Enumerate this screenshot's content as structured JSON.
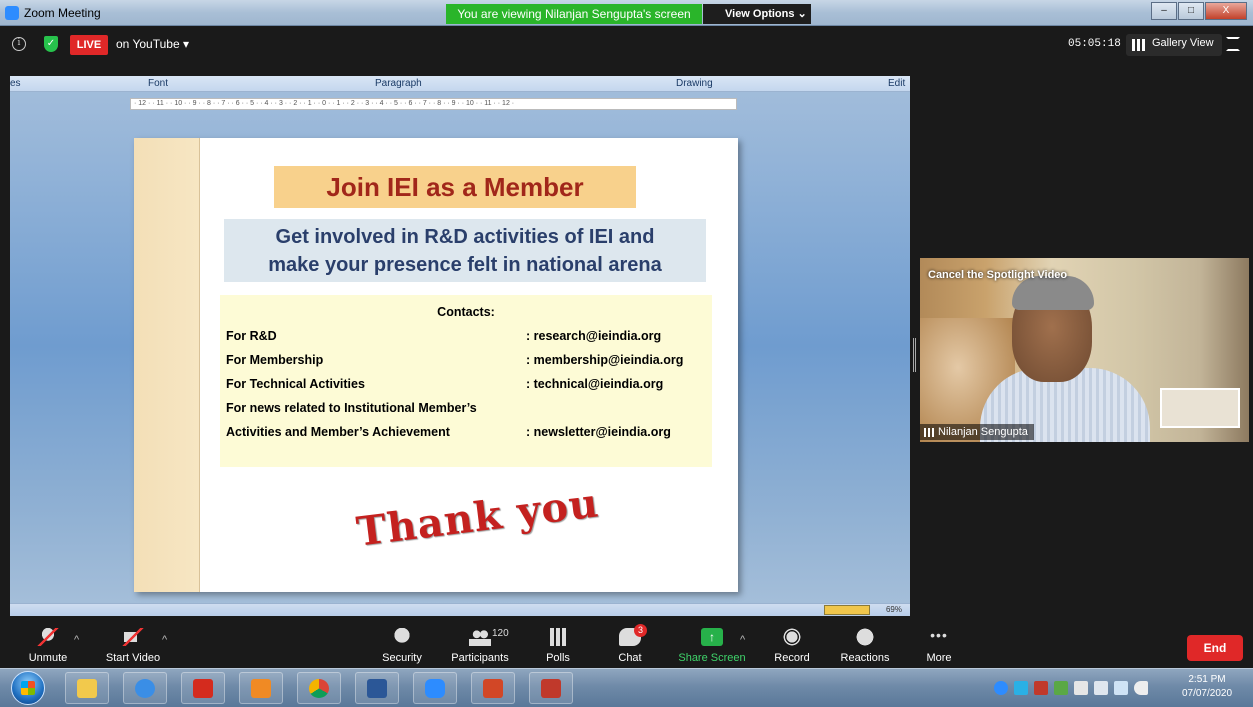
{
  "window": {
    "title": "Zoom Meeting",
    "viewing_banner": "You are viewing Nilanjan Sengupta's screen",
    "view_options": "View Options ⌄",
    "controls": [
      "–",
      "□",
      "X"
    ]
  },
  "meeting_bar": {
    "live_label": "LIVE",
    "live_destination": "on YouTube ▾",
    "timer": "05:05:18",
    "gallery_view": "Gallery View"
  },
  "shared_screen": {
    "ribbon_groups": [
      "es",
      "Font",
      "Paragraph",
      "Drawing",
      "Edit"
    ],
    "ruler_text": "· 12 · · 11 · · 10 · · 9 · · 8 · · 7 · · 6 · · 5 · · 4 · · 3 · · 2 · · 1 · · 0 · · 1 · · 2 · · 3 · · 4 · · 5 · · 6 · · 7 · · 8 · · 9 · · 10 · · 11 · · 12 ·",
    "zoom_level": "69%",
    "slide": {
      "title": "Join IEI as a Member",
      "subtitle_line1": "Get involved in R&D activities of IEI and",
      "subtitle_line2": "make your presence felt in national arena",
      "contacts_heading": "Contacts:",
      "contacts": [
        {
          "label": "For R&D",
          "value": ": research@ieindia.org"
        },
        {
          "label": "For Membership",
          "value": ": membership@ieindia.org"
        },
        {
          "label": "For Technical Activities",
          "value": ": technical@ieindia.org"
        },
        {
          "label": "For news related to Institutional Member’s",
          "value": ""
        },
        {
          "label": "Activities and Member’s Achievement",
          "value": ": newsletter@ieindia.org"
        }
      ],
      "closing": "Thank you"
    }
  },
  "video": {
    "spotlight_action": "Cancel the Spotlight Video",
    "participant_name": "Nilanjan Sengupta"
  },
  "toolbar": {
    "unmute": "Unmute",
    "start_video": "Start Video",
    "security": "Security",
    "participants": "Participants",
    "participants_count": "120",
    "polls": "Polls",
    "chat": "Chat",
    "chat_badge": "3",
    "share_screen": "Share Screen",
    "record": "Record",
    "reactions": "Reactions",
    "more": "More",
    "end": "End"
  },
  "taskbar": {
    "time": "2:51 PM",
    "date": "07/07/2020"
  },
  "colors": {
    "live_red": "#e02828",
    "share_green": "#27b14a",
    "banner_green": "#2ab52a",
    "slide_title_red": "#a1271a"
  }
}
